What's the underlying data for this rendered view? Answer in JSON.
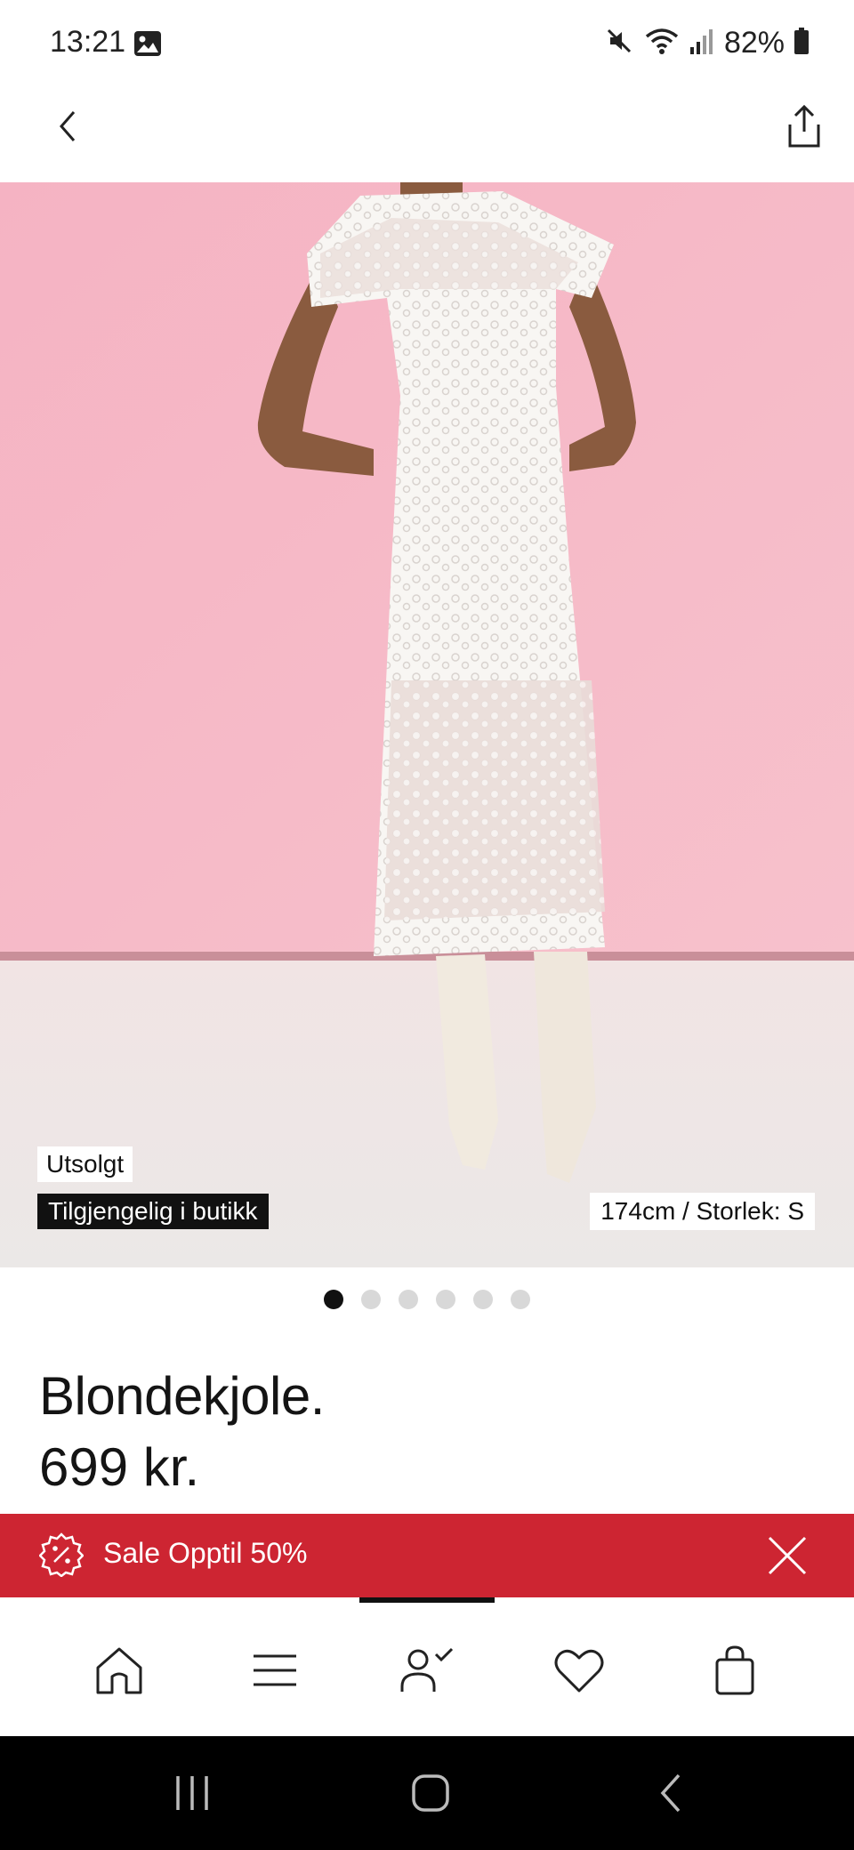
{
  "status_bar": {
    "time": "13:21",
    "battery": "82%",
    "icons": [
      "photo-icon",
      "mute-icon",
      "wifi-icon",
      "signal-icon",
      "battery-icon"
    ]
  },
  "header": {
    "back_icon": "chevron-left-icon",
    "share_icon": "share-icon"
  },
  "product": {
    "image_alt": "White lace dress",
    "badge_soldout": "Utsolgt",
    "badge_store": "Tilgjengelig i butikk",
    "model_info": "174cm / Storlek: S",
    "image_count": 6,
    "active_image": 1,
    "title": "Blondekjole.",
    "price": "699 kr."
  },
  "sale_banner": {
    "text": "Sale Opptil 50%",
    "icon": "discount-badge-icon",
    "close_icon": "close-icon",
    "background": "#cd2532"
  },
  "bottom_nav": {
    "items": [
      {
        "name": "home",
        "icon": "home-icon"
      },
      {
        "name": "menu",
        "icon": "menu-icon"
      },
      {
        "name": "account",
        "icon": "account-icon"
      },
      {
        "name": "favorites",
        "icon": "heart-icon"
      },
      {
        "name": "cart",
        "icon": "bag-icon"
      }
    ]
  },
  "system_nav": {
    "items": [
      "recents-icon",
      "home-circle-icon",
      "back-icon"
    ]
  },
  "colors": {
    "backdrop_pink": "#f3b8c6",
    "floor": "#eeeae8",
    "accent_red": "#cd2532"
  }
}
